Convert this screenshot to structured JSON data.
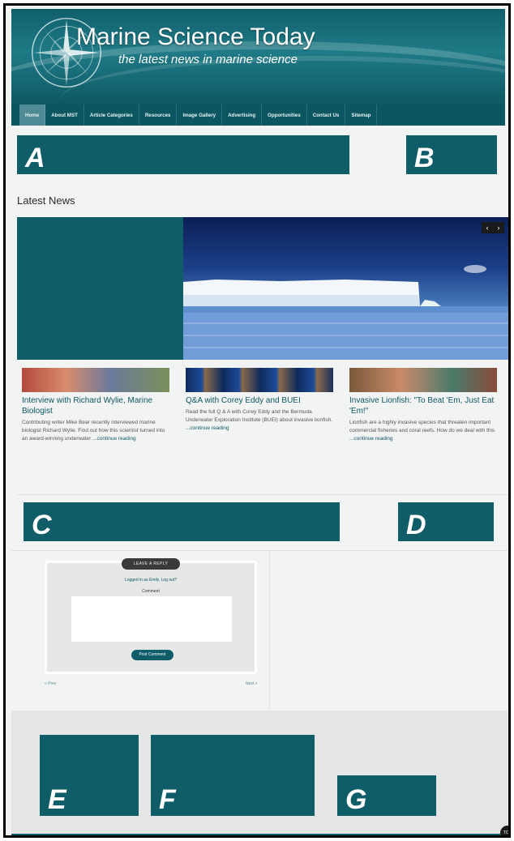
{
  "header": {
    "title": "Marine Science Today",
    "tagline": "the latest news in marine science"
  },
  "nav": {
    "items": [
      "Home",
      "About MST",
      "Article Categories",
      "Resources",
      "Image Gallery",
      "Advertising",
      "Opportunities",
      "Contact Us",
      "Sitemap"
    ]
  },
  "blocks": {
    "a": "A",
    "b": "B",
    "c": "C",
    "d": "D",
    "e": "E",
    "f": "F",
    "g": "G"
  },
  "latest_news": {
    "heading": "Latest News",
    "slider_prev": "‹",
    "slider_next": "›"
  },
  "articles": [
    {
      "title": "Interview with Richard Wylie, Marine Biologist",
      "excerpt": "Contributing writer Mike Bear recently interviewed marine biologist Richard Wylie. Find out how this scientist turned into an award-winning underwater",
      "more": "...continue reading"
    },
    {
      "title": "Q&A with Corey Eddy and BUEI",
      "excerpt": "Read the full Q & A with Corey Eddy and the Bermuda Underwater Exploration Institute (BUEI) about invasive lionfish.",
      "more": "...continue reading"
    },
    {
      "title": "Invasive Lionfish: \"To Beat 'Em, Just Eat 'Em!\"",
      "excerpt": "Lionfish are a highly invasive species that threaten important commercial fisheries and coral reefs. How do we deal with this",
      "more": "...continue reading"
    }
  ],
  "comments": {
    "leave_reply": "LEAVE A REPLY",
    "logged_in": "Logged in as Emily. Log out?",
    "comment_label": "Comment",
    "post_button": "Post Comment",
    "prev": "« Prev",
    "next": "Next »"
  },
  "footer": {
    "top_button": "TOP"
  },
  "colors": {
    "brand": "#0e5d68",
    "nav": "#0c5662",
    "nav_active": "#4f8b94"
  }
}
